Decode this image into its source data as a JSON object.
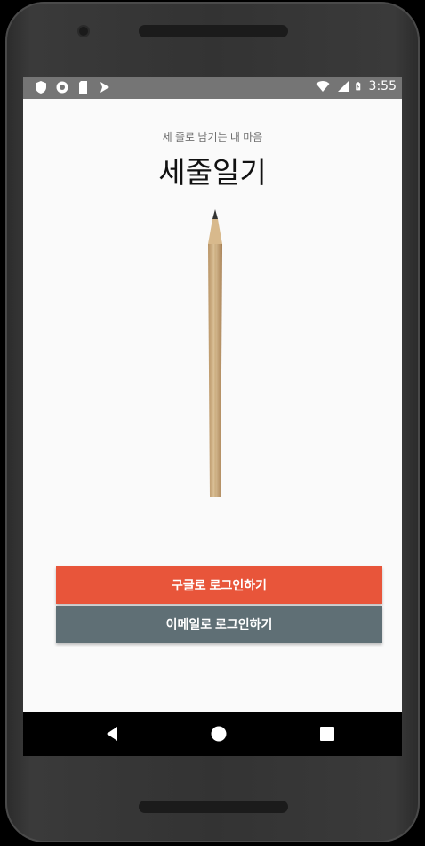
{
  "status_bar": {
    "time": "3:55",
    "left_icons": [
      "shield-icon",
      "circle-icon",
      "sim-card-icon",
      "app-icon"
    ],
    "right_icons": [
      "wifi-icon",
      "signal-icon",
      "battery-icon"
    ]
  },
  "app": {
    "tagline": "세 줄로 남기는 내 마음",
    "title": "세줄일기",
    "illustration": "pencil-illustration"
  },
  "buttons": {
    "google_login": "구글로 로그인하기",
    "email_login": "이메일로 로그인하기"
  },
  "colors": {
    "google_button": "#e8553a",
    "email_button": "#5f6f75",
    "status_bar": "#757575",
    "screen_background": "#fafafa"
  },
  "navigation": {
    "icons": [
      "back-icon",
      "home-icon",
      "recents-icon"
    ]
  }
}
